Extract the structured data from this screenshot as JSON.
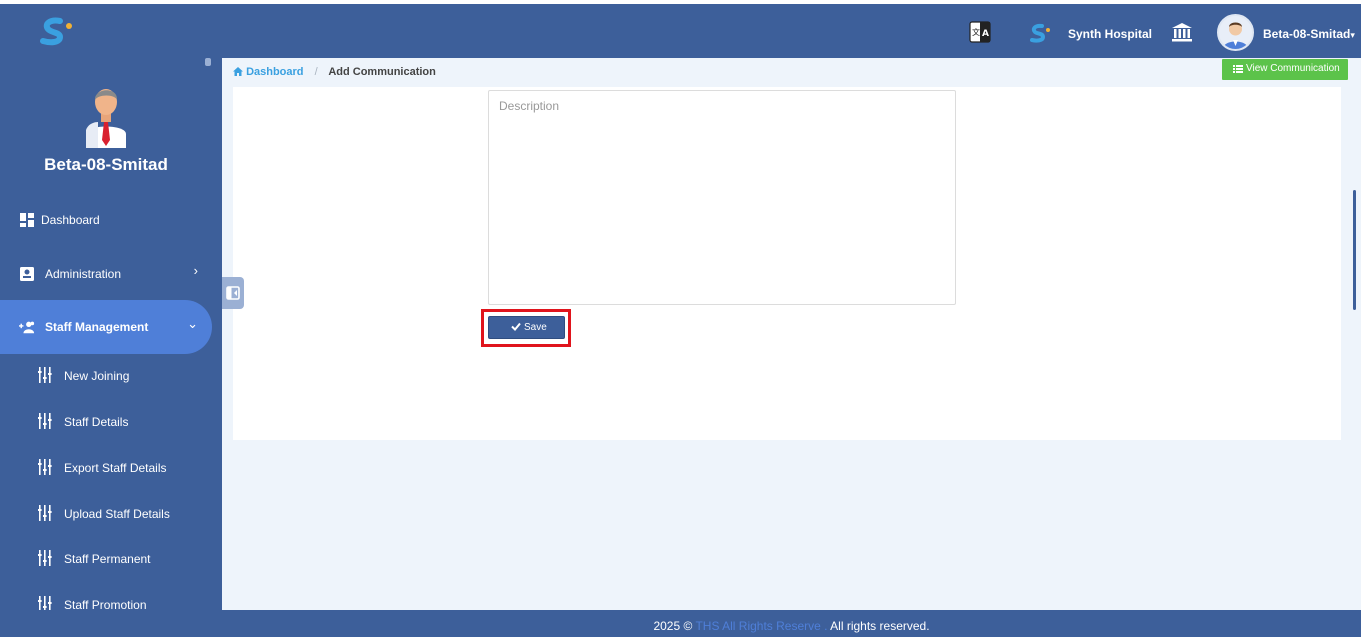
{
  "topbar": {
    "hospital_name": "Synth Hospital",
    "user_name": "Beta-08-Smitad",
    "user_caret": "▾"
  },
  "sidebar": {
    "profile_name": "Beta-08-Smitad",
    "items": [
      {
        "label": "Dashboard",
        "icon": "dashboard-icon"
      },
      {
        "label": "Administration",
        "icon": "admin-icon",
        "chevron": "›"
      },
      {
        "label": "Staff Management",
        "icon": "staff-icon",
        "chevron": "⌄",
        "active": true
      }
    ],
    "sub_items": [
      {
        "label": "New Joining"
      },
      {
        "label": "Staff Details"
      },
      {
        "label": "Export Staff Details"
      },
      {
        "label": "Upload Staff Details"
      },
      {
        "label": "Staff Permanent"
      },
      {
        "label": "Staff Promotion"
      }
    ]
  },
  "breadcrumb": {
    "home": "Dashboard",
    "separator": "/",
    "current": "Add Communication"
  },
  "header_button": {
    "label": "View Communication"
  },
  "form": {
    "description_placeholder": "Description",
    "save_label": "Save"
  },
  "footer": {
    "year": "2025 ©",
    "brand": "THS All Rights Reserve .",
    "rights": "All rights reserved."
  },
  "colors": {
    "primary": "#3d5f9a",
    "active_nav": "#4f7fd8",
    "success": "#5cc34a",
    "highlight": "#e0141c"
  }
}
